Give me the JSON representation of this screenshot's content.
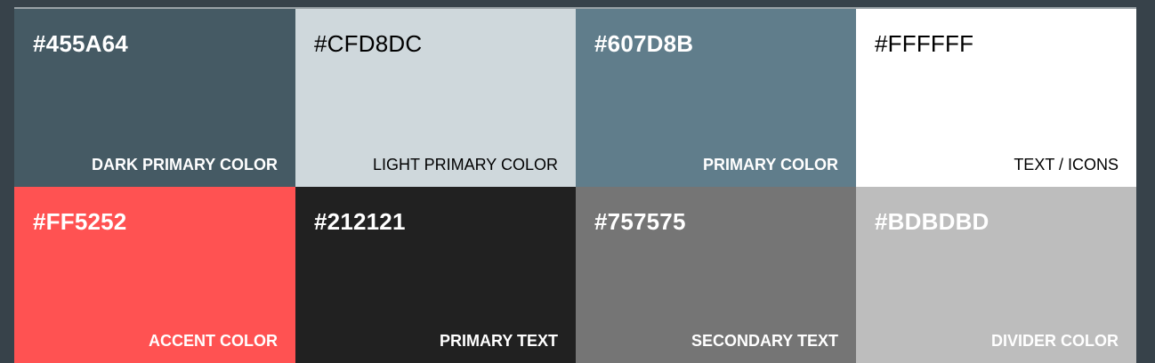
{
  "palette": {
    "swatches": [
      {
        "hex": "#455A64",
        "name": "DARK PRIMARY COLOR",
        "bg": "#455A64",
        "fg": "#FFFFFF"
      },
      {
        "hex": "#CFD8DC",
        "name": "LIGHT PRIMARY COLOR",
        "bg": "#CFD8DC",
        "fg": "#000000"
      },
      {
        "hex": "#607D8B",
        "name": "PRIMARY COLOR",
        "bg": "#607D8B",
        "fg": "#FFFFFF"
      },
      {
        "hex": "#FFFFFF",
        "name": "TEXT / ICONS",
        "bg": "#FFFFFF",
        "fg": "#000000"
      },
      {
        "hex": "#FF5252",
        "name": "ACCENT COLOR",
        "bg": "#FF5252",
        "fg": "#FFFFFF"
      },
      {
        "hex": "#212121",
        "name": "PRIMARY TEXT",
        "bg": "#212121",
        "fg": "#FFFFFF"
      },
      {
        "hex": "#757575",
        "name": "SECONDARY TEXT",
        "bg": "#757575",
        "fg": "#FFFFFF"
      },
      {
        "hex": "#BDBDBD",
        "name": "DIVIDER COLOR",
        "bg": "#BDBDBD",
        "fg": "#FFFFFF"
      }
    ]
  }
}
